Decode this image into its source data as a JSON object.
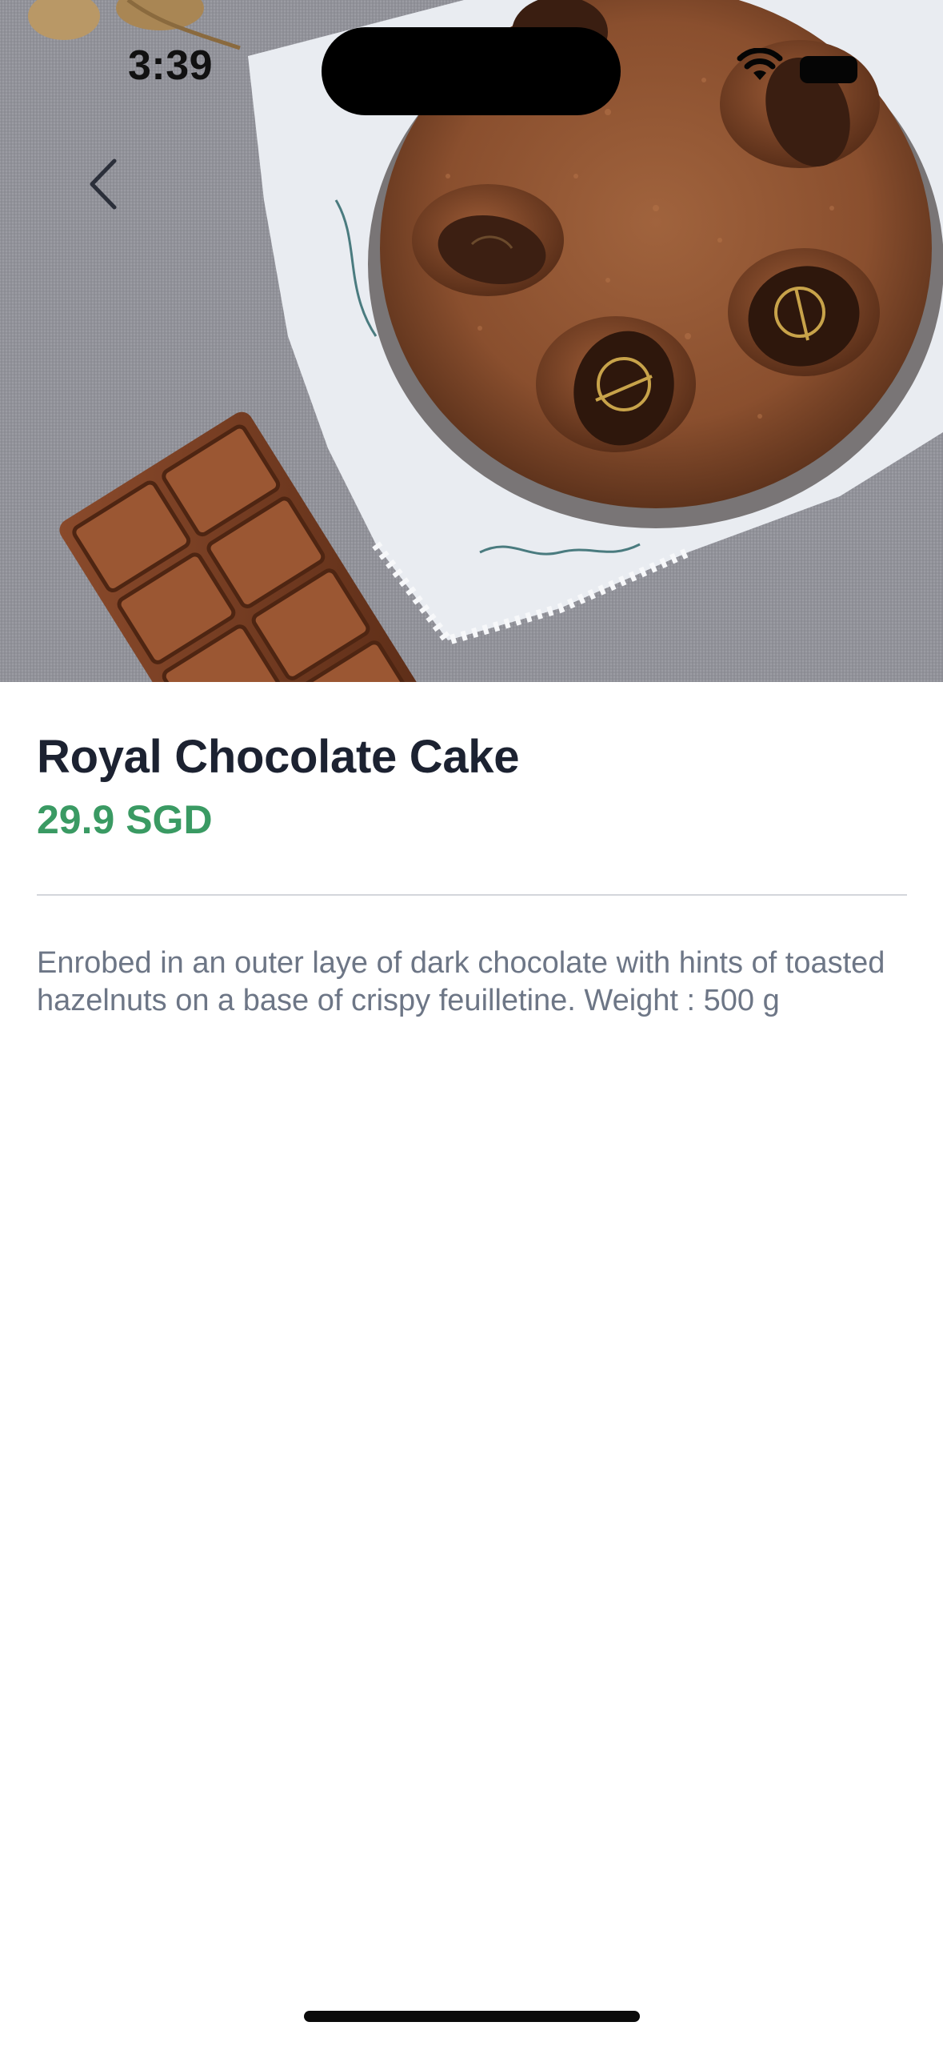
{
  "status_bar": {
    "time": "3:39",
    "icons": [
      "wifi-icon",
      "battery-icon"
    ]
  },
  "navigation": {
    "back_icon": "chevron-left-icon"
  },
  "product": {
    "name": "Royal Chocolate Cake",
    "price": "29.9 SGD",
    "description": "Enrobed in an outer laye of dark chocolate with hints of toasted hazelnuts on a base of crispy feuilletine. Weight : 500 g"
  },
  "colors": {
    "title": "#1c2231",
    "price": "#3a9a63",
    "description": "#6d7686",
    "divider": "#d3d6db"
  }
}
